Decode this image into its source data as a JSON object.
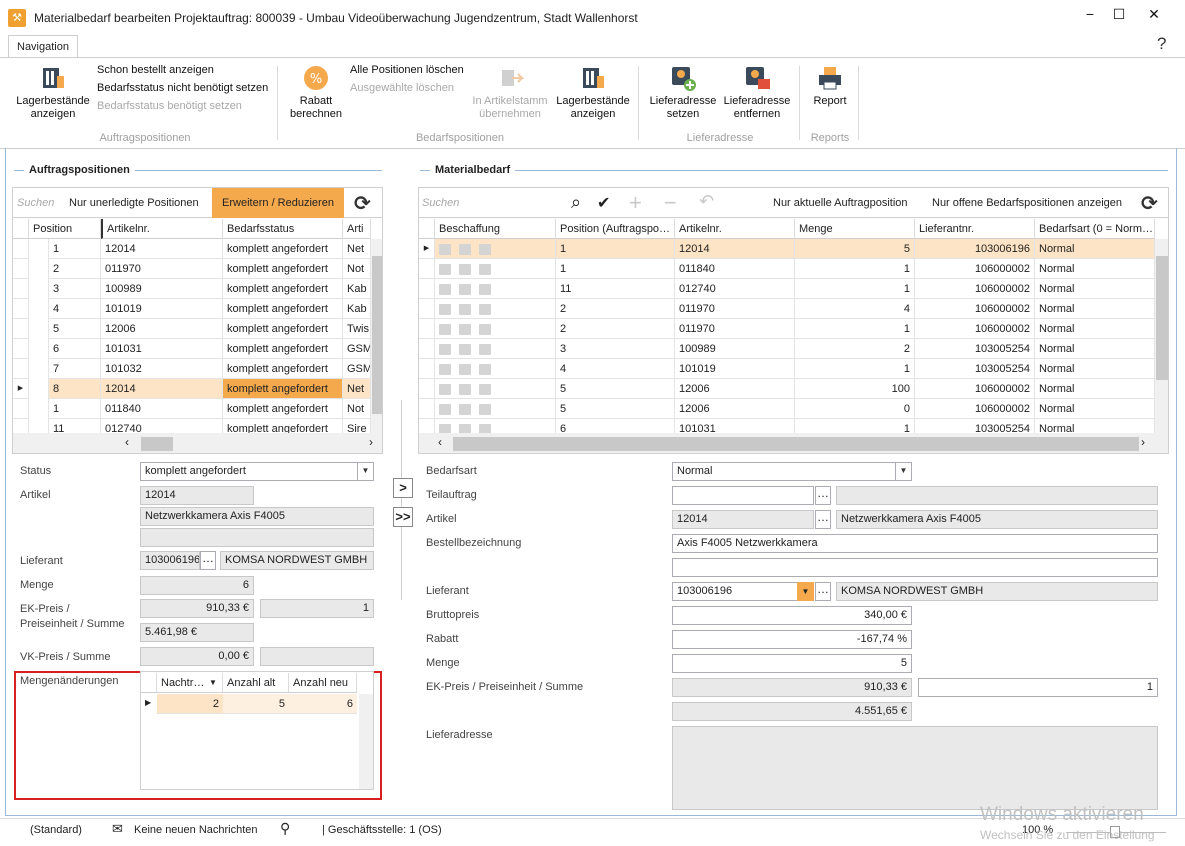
{
  "window": {
    "title": "Materialbedarf bearbeiten Projektauftrag: 800039 - Umbau Videoüberwachung Jugendzentrum, Stadt Wallenhorst",
    "minimize": "−",
    "maximize": "☐",
    "close": "✕"
  },
  "ribbon": {
    "tab": "Navigation",
    "help": "?",
    "btn_lager1": "Lagerbestände anzeigen",
    "small1": "Schon bestellt anzeigen",
    "small2": "Bedarfsstatus nicht benötigt setzen",
    "small3": "Bedarfsstatus benötigt setzen",
    "grp1": "Auftragspositionen",
    "btn_rabatt": "Rabatt berechnen",
    "small4": "Alle Positionen löschen",
    "small5": "Ausgewählte löschen",
    "btn_stamm": "In Artikelstamm übernehmen",
    "btn_lager2": "Lagerbestände anzeigen",
    "grp2": "Bedarfspositionen",
    "btn_lief_set": "Lieferadresse setzen",
    "btn_lief_del": "Lieferadresse entfernen",
    "grp3": "Lieferadresse",
    "btn_report": "Report",
    "grp4": "Reports",
    "rabatt_symbol": "%"
  },
  "left": {
    "section": "Auftragspositionen",
    "search_placeholder": "Suchen",
    "filter_btn": "Nur unerledigte Positionen",
    "expand_btn": "Erweitern / Reduzieren",
    "refresh": "⟳",
    "columns": [
      "Position",
      "Artikelnr.",
      "Bedarfsstatus",
      "Arti"
    ],
    "rows": [
      [
        "1",
        "12014",
        "komplett angefordert",
        "Net"
      ],
      [
        "2",
        "011970",
        "komplett angefordert",
        "Not"
      ],
      [
        "3",
        "100989",
        "komplett angefordert",
        "Kab"
      ],
      [
        "4",
        "101019",
        "komplett angefordert",
        "Kab"
      ],
      [
        "5",
        "12006",
        "komplett angefordert",
        "Twis"
      ],
      [
        "6",
        "101031",
        "komplett angefordert",
        "GSM"
      ],
      [
        "7",
        "101032",
        "komplett angefordert",
        "GSM"
      ],
      [
        "8",
        "12014",
        "komplett angefordert",
        "Net"
      ],
      [
        "1",
        "011840",
        "komplett angefordert",
        "Not"
      ],
      [
        "11",
        "012740",
        "komplett angefordert",
        "Sire"
      ]
    ],
    "form": {
      "status_label": "Status",
      "status_value": "komplett angefordert",
      "artikel_label": "Artikel",
      "artikel_nr": "12014",
      "artikel_name": "Netzwerkkamera Axis F4005",
      "artikel_extra": "",
      "lieferant_label": "Lieferant",
      "lieferant_nr": "103006196",
      "lieferant_name": "KOMSA NORDWEST GMBH",
      "menge_label": "Menge",
      "menge_value": "6",
      "ek_label1": "EK-Preis /",
      "ek_label2": "Preiseinheit / Summe",
      "ek_value": "910,33 €",
      "ek_unit": "1",
      "ek_sum": "5.461,98 €",
      "vk_label": "VK-Preis / Summe",
      "vk_value": "0,00 €",
      "vk_sum": "",
      "mengen_label": "Mengenänderungen",
      "mengen_cols": [
        "Nachtr…",
        "Anzahl alt",
        "Anzahl neu"
      ],
      "mengen_row": [
        "2",
        "5",
        "6"
      ]
    }
  },
  "transfer": {
    "one": ">",
    "all": ">>"
  },
  "right": {
    "section": "Materialbedarf",
    "search_placeholder": "Suchen",
    "search_icon": "⌕",
    "check_icon": "✔",
    "plus_icon": "+",
    "minus_icon": "−",
    "undo_icon": "↶",
    "filter1": "Nur aktuelle Auftragposition",
    "filter2": "Nur offene Bedarfspositionen anzeigen",
    "refresh": "⟳",
    "columns": [
      "Beschaffung",
      "Position (Auftragspo…",
      "Artikelnr.",
      "Menge",
      "Lieferantnr.",
      "Bedarfsart (0 = Norm…"
    ],
    "rows": [
      [
        "1",
        "12014",
        "5",
        "103006196",
        "Normal"
      ],
      [
        "1",
        "011840",
        "1",
        "106000002",
        "Normal"
      ],
      [
        "11",
        "012740",
        "1",
        "106000002",
        "Normal"
      ],
      [
        "2",
        "011970",
        "4",
        "106000002",
        "Normal"
      ],
      [
        "2",
        "011970",
        "1",
        "106000002",
        "Normal"
      ],
      [
        "3",
        "100989",
        "2",
        "103005254",
        "Normal"
      ],
      [
        "4",
        "101019",
        "1",
        "103005254",
        "Normal"
      ],
      [
        "5",
        "12006",
        "100",
        "106000002",
        "Normal"
      ],
      [
        "5",
        "12006",
        "0",
        "106000002",
        "Normal"
      ],
      [
        "6",
        "101031",
        "1",
        "103005254",
        "Normal"
      ]
    ],
    "form": {
      "bedarfsart_label": "Bedarfsart",
      "bedarfsart_value": "Normal",
      "teilauftrag_label": "Teilauftrag",
      "teilauftrag_value": "",
      "artikel_label": "Artikel",
      "artikel_nr": "12014",
      "artikel_name": "Netzwerkkamera Axis F4005",
      "bestell_label": "Bestellbezeichnung",
      "bestell_value": "Axis F4005 Netzwerkkamera",
      "bestell_value2": "",
      "lieferant_label": "Lieferant",
      "lieferant_nr": "103006196",
      "lieferant_name": "KOMSA NORDWEST GMBH",
      "brutto_label": "Bruttopreis",
      "brutto_value": "340,00 €",
      "rabatt_label": "Rabatt",
      "rabatt_value": "-167,74 %",
      "menge_label": "Menge",
      "menge_value": "5",
      "ek_label": "EK-Preis / Preiseinheit / Summe",
      "ek_value": "910,33 €",
      "ek_unit": "1",
      "ek_sum": "4.551,65 €",
      "lieferadresse_label": "Lieferadresse",
      "lieferadresse_value": ""
    }
  },
  "status": {
    "standard": "(Standard)",
    "mail_icon": "✉",
    "messages": "Keine neuen Nachrichten",
    "search_icon": "⚲",
    "branch": "| Geschäftsstelle: 1 (OS)",
    "zoom": "100 %"
  },
  "watermark": {
    "line1": "Windows aktivieren",
    "line2": "Wechseln Sie zu den Einstellung"
  },
  "colors": {
    "accent_orange": "#f5a94d",
    "selected_row": "#fde4c6",
    "highlight_border": "#d62020",
    "frame_blue": "#9ab8d8"
  }
}
